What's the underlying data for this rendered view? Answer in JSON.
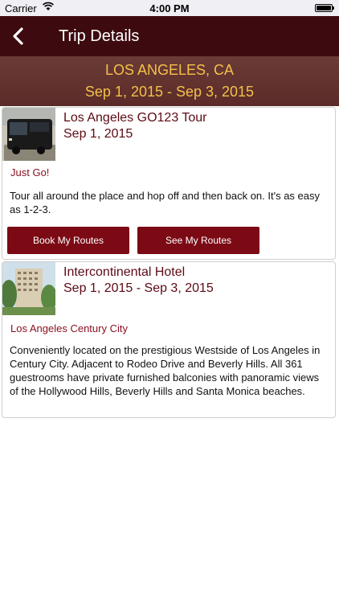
{
  "status_bar": {
    "carrier": "Carrier",
    "time": "4:00 PM"
  },
  "nav": {
    "title": "Trip Details"
  },
  "trip": {
    "city": "LOS ANGELES, CA",
    "dates": "Sep 1, 2015 - Sep 3, 2015"
  },
  "items": [
    {
      "title": "Los Angeles GO123 Tour",
      "date": "Sep 1, 2015",
      "tag": "Just Go!",
      "description": "Tour all around the place and hop off and then back on. It's as easy as 1-2-3.",
      "buttons": {
        "book": "Book My Routes",
        "see": "See My Routes"
      }
    },
    {
      "title": "Intercontinental Hotel",
      "date": "Sep 1, 2015 - Sep 3, 2015",
      "tag": "Los Angeles Century City",
      "description": "Conveniently located on the prestigious Westside of Los Angeles in Century City. Adjacent to Rodeo Drive and Beverly Hills. All 361 guestrooms have private furnished balconies with panoramic views of the Hollywood Hills, Beverly Hills and Santa Monica beaches."
    }
  ],
  "colors": {
    "nav_bg": "#3d0a0f",
    "accent": "#7b0a14",
    "header_text": "#f4c04a"
  }
}
